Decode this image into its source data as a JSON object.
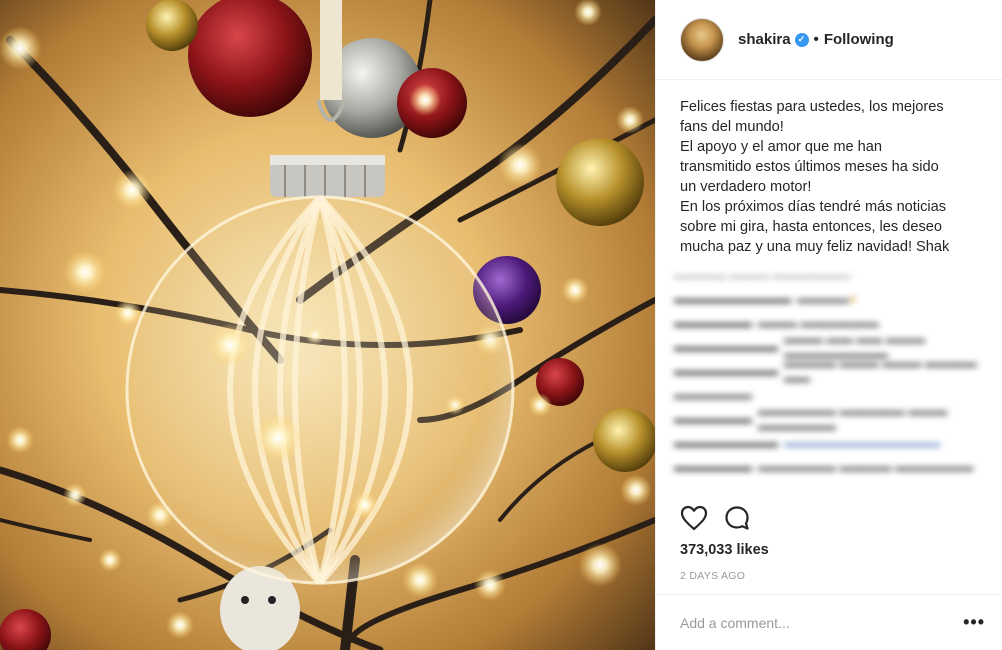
{
  "post": {
    "username": "shakira",
    "separator": "•",
    "follow_label": "Following",
    "caption": "Felices fiestas para ustedes, los mejores\nfans del mundo!\nEl apoyo y el amor que me han\ntransmitido estos últimos meses ha sido\nun verdadero motor!\nEn los próximos días tendré más noticias\nsobre mi gira, hasta  entonces, les deseo\nmucha paz y una muy feliz navidad! Shak",
    "likes": "373,033 likes",
    "time": "2 DAYS AGO",
    "comment_placeholder": "Add a comment...",
    "more_label": "•••"
  },
  "icons": {
    "verified": "verified-badge-icon",
    "like": "heart-icon",
    "comment": "comment-bubble-icon",
    "more": "more-options-icon"
  },
  "colors": {
    "verified": "#3897f0",
    "text": "#262626",
    "muted": "#999999",
    "divider": "#efefef"
  }
}
